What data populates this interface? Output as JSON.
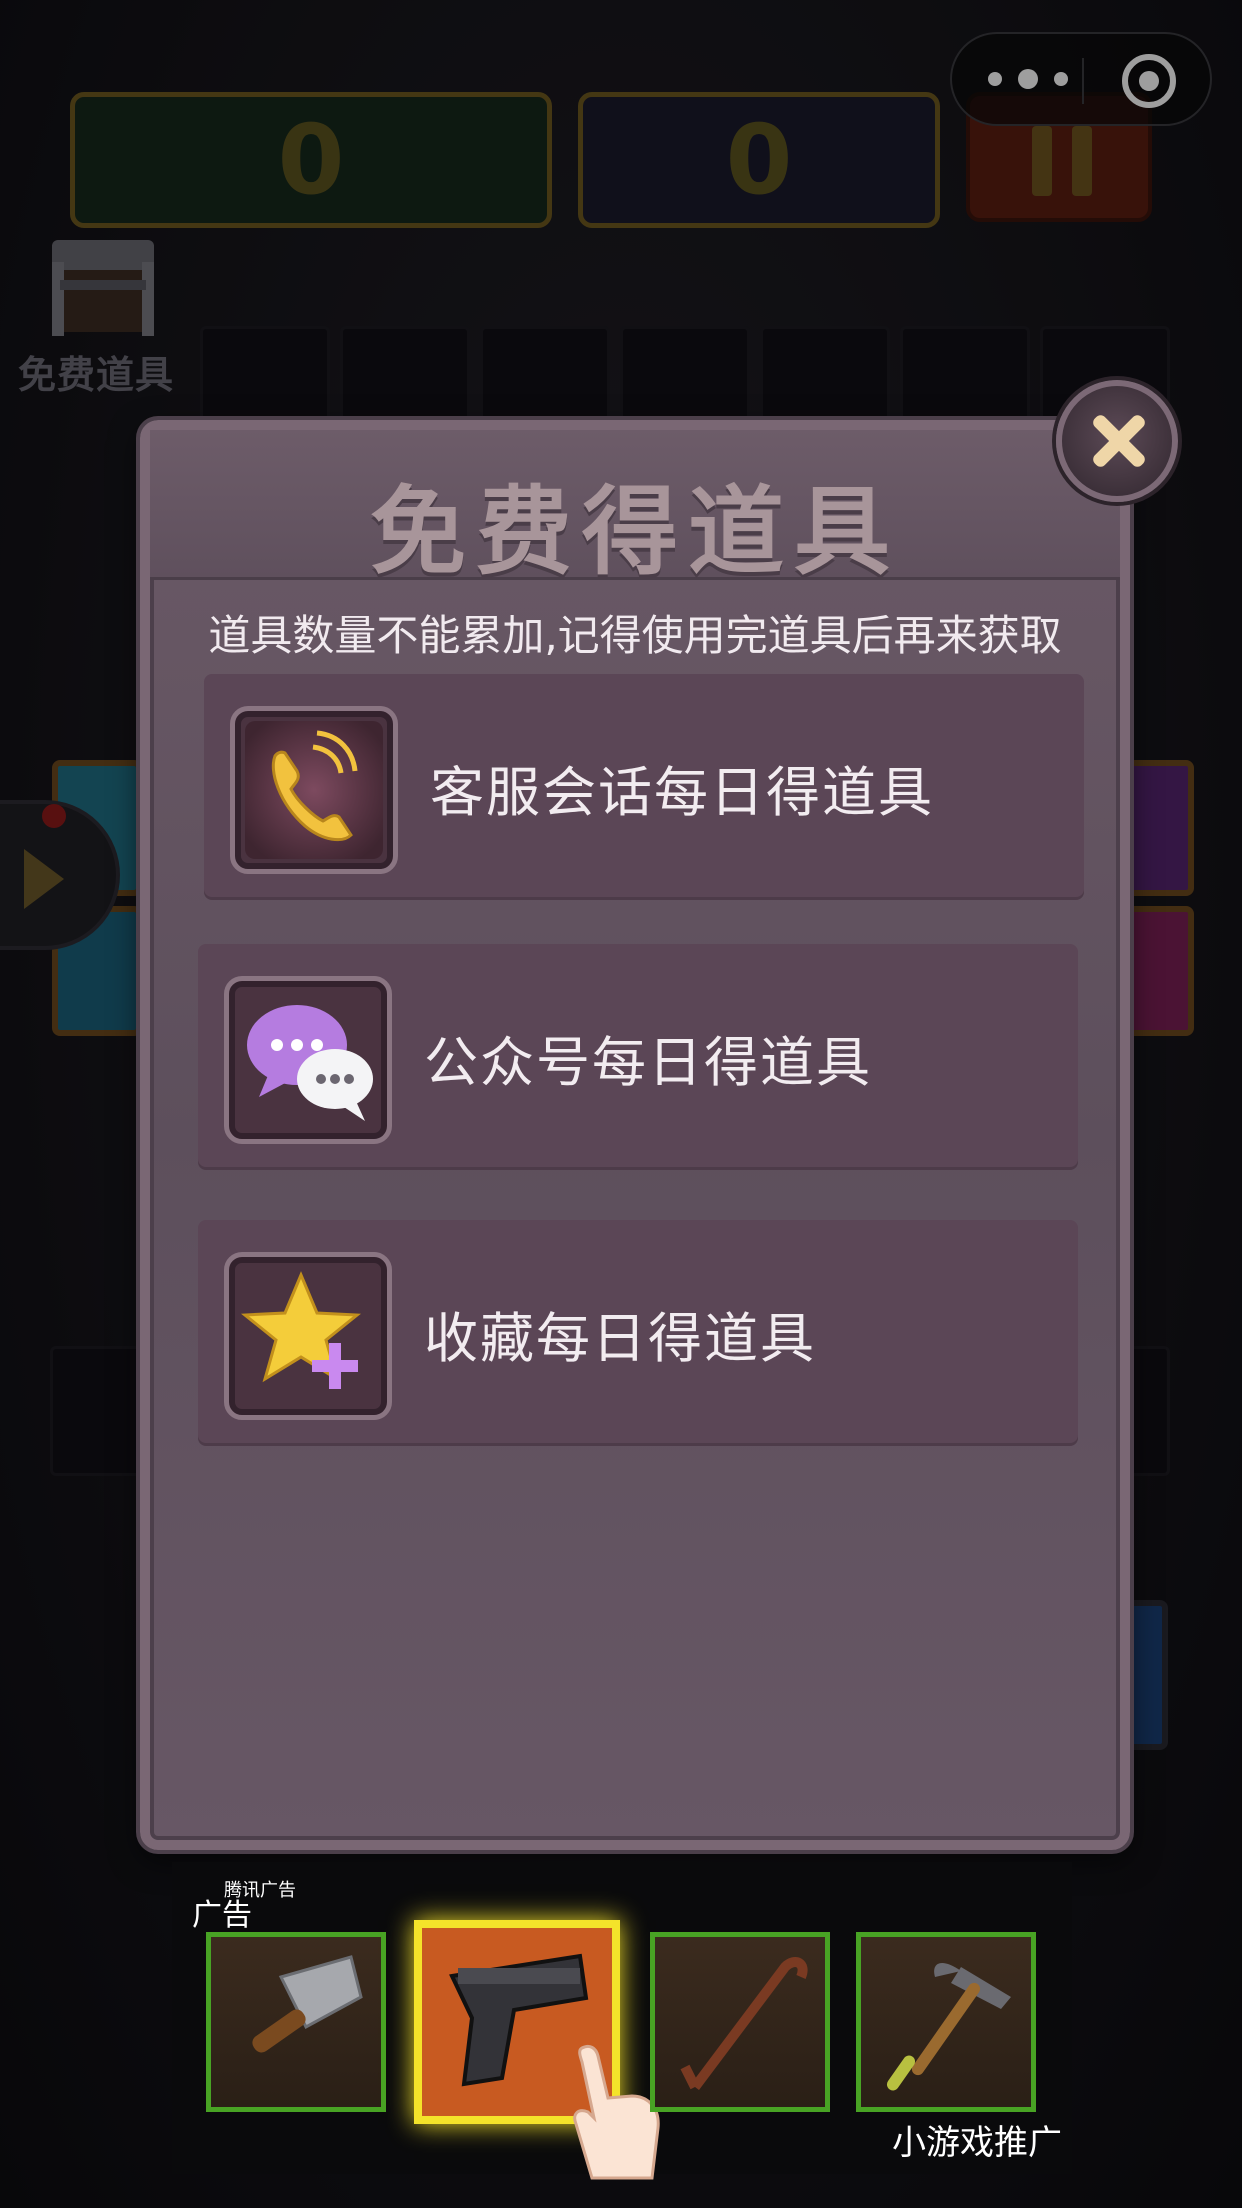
{
  "game": {
    "score": "0",
    "best_score": "0",
    "free_items_label": "免费道具"
  },
  "modal": {
    "title": "免费得道具",
    "notice": "道具数量不能累加,记得使用完道具后再来获取",
    "options": [
      {
        "label": "客服会话每日得道具",
        "icon": "phone-icon"
      },
      {
        "label": "公众号每日得道具",
        "icon": "chat-bubbles-icon"
      },
      {
        "label": "收藏每日得道具",
        "icon": "star-plus-icon"
      }
    ]
  },
  "ad": {
    "label": "广告",
    "source": "腾讯广告",
    "promo": "小游戏推广",
    "items": [
      {
        "icon": "cleaver-icon"
      },
      {
        "icon": "pistol-icon"
      },
      {
        "icon": "crowbar-icon"
      },
      {
        "icon": "hammer-icon"
      }
    ]
  },
  "colors": {
    "modal_bg": "#5d4f5c",
    "row_bg": "#5b4656",
    "close_x": "#efd6a8",
    "ad_selected": "#f4e32a"
  }
}
